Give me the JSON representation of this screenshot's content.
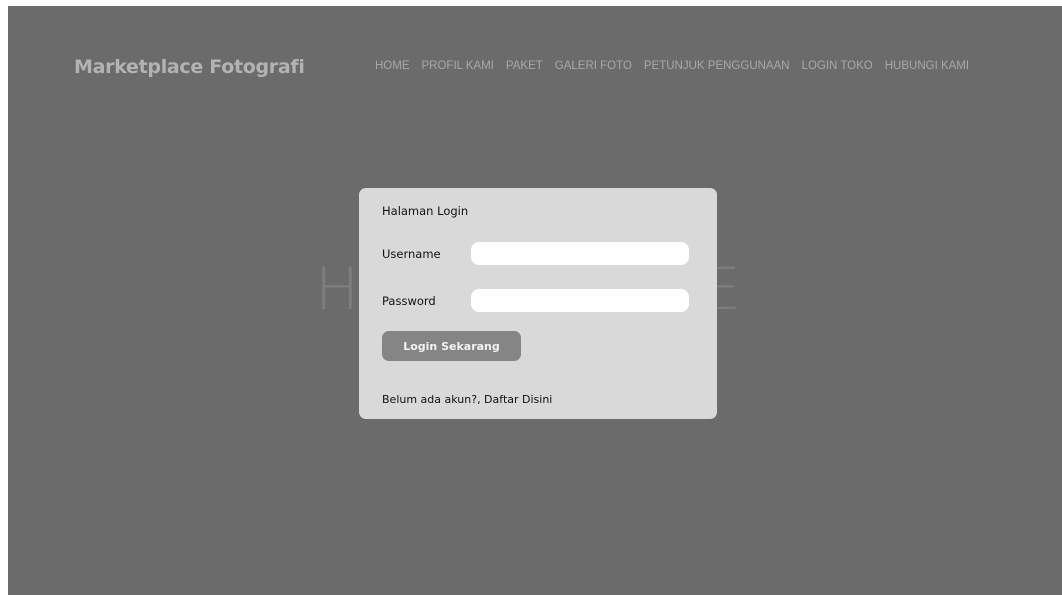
{
  "header": {
    "logo": "Marketplace Fotografi",
    "nav": [
      "HOME",
      "PROFIL KAMI",
      "PAKET",
      "GALERI FOTO",
      "PETUNJUK PENGGUNAAN",
      "LOGIN TOKO",
      "HUBUNGI KAMI"
    ]
  },
  "hero": {
    "title": "Marketplace Fotografi",
    "subtitle": "HOMEPAGE"
  },
  "login": {
    "title": "Halaman Login",
    "username_label": "Username",
    "username_value": "",
    "password_label": "Password",
    "password_value": "",
    "button_label": "Login Sekarang",
    "register_text": "Belum ada akun?, Daftar Disini"
  },
  "colors": {
    "page_background": "#6b6b6b",
    "modal_background": "#d9d9d9",
    "button_background": "#858585"
  }
}
